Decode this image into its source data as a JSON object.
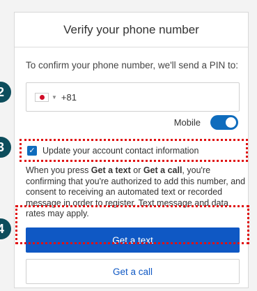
{
  "dialog": {
    "title": "Verify your phone number",
    "intro": "To confirm your phone number, we'll send a PIN to:"
  },
  "phone": {
    "country_code": "+81",
    "flag_icon": "japan-flag-icon"
  },
  "mobile": {
    "label": "Mobile",
    "enabled": true
  },
  "contact_update": {
    "label": "Update your account contact information",
    "checked": true
  },
  "consent": {
    "part1": "When you press ",
    "get_text": "Get a text",
    "part2": " or ",
    "get_call": "Get a call",
    "part3": ", you're confirming that you're authorized to add this number, and consent to receiving an automated text or recorded message in order to register. Text message and data rates may apply."
  },
  "buttons": {
    "get_text": "Get a text",
    "get_call": "Get a call"
  },
  "annotations": {
    "marker_phone": "2",
    "marker_checkbox": "3",
    "marker_button": "4",
    "highlight_color": "#e01010",
    "marker_color": "#0d4d5c"
  },
  "colors": {
    "accent": "#0f58c4",
    "toggle": "#0f6cbd"
  }
}
